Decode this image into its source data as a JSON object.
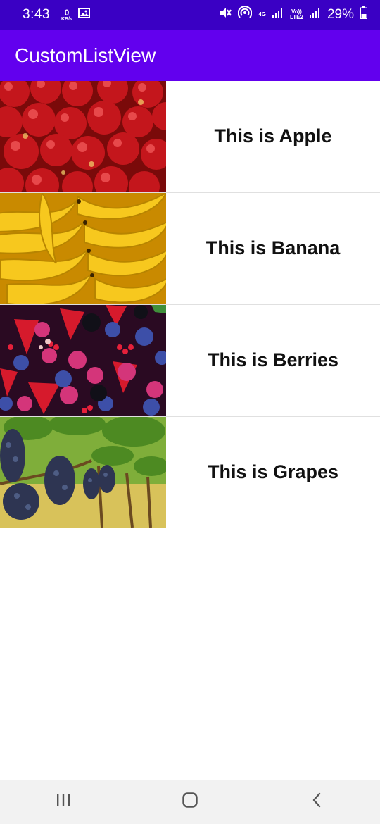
{
  "status_bar": {
    "time": "3:43",
    "net_speed_value": "0",
    "net_speed_unit": "KB/s",
    "network_4g": "4G",
    "volte_top": "Vo))",
    "volte_bottom": "LTE2",
    "battery": "29%",
    "icons": [
      "gallery-icon",
      "mute-icon",
      "hotspot-icon",
      "signal-icon",
      "battery-icon"
    ]
  },
  "app_bar": {
    "title": "CustomListView"
  },
  "list": {
    "items": [
      {
        "label": "This is Apple",
        "image": "apples"
      },
      {
        "label": "This is Banana",
        "image": "bananas"
      },
      {
        "label": "This is Berries",
        "image": "berries"
      },
      {
        "label": "This is Grapes",
        "image": "grapes"
      }
    ]
  },
  "nav_bar": {
    "icons": [
      "recents-icon",
      "home-icon",
      "back-icon"
    ]
  },
  "colors": {
    "status_bar": "#3a00c4",
    "app_bar": "#6200ee",
    "divider": "#e0e0e0"
  }
}
